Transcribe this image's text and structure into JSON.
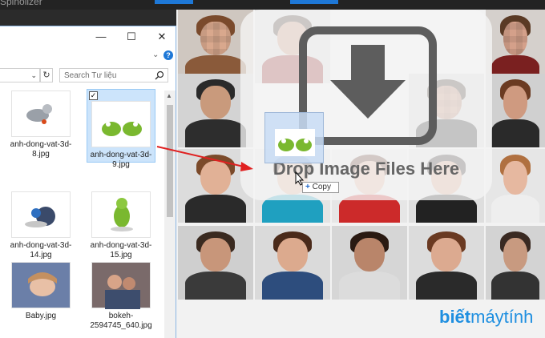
{
  "topbar": {
    "title": "Spinolizer"
  },
  "explorer": {
    "window_controls": {
      "minimize": "—",
      "maximize": "☐",
      "close": "✕"
    },
    "search_placeholder": "Search Tư liệu",
    "help": "?",
    "files": [
      {
        "name": "anh-dong-vat-3d-8.jpg",
        "selected": false
      },
      {
        "name": "anh-dong-vat-3d-9.jpg",
        "selected": true
      },
      {
        "name": "anh-dong-vat-3d-14.jpg",
        "selected": false
      },
      {
        "name": "anh-dong-vat-3d-15.jpg",
        "selected": false
      },
      {
        "name": "Baby.jpg",
        "selected": false
      },
      {
        "name": "bokeh-2594745_640.jpg",
        "selected": false
      }
    ]
  },
  "drop_zone": {
    "label": "Drop Image Files Here"
  },
  "drag": {
    "copy_label": "Copy"
  },
  "watermark": {
    "brand": "biết",
    "brand2": "máytính"
  },
  "colors": {
    "accent": "#1e78d7",
    "arrow": "#e02020",
    "watermark": "#1f8fe0"
  },
  "icons": [
    "search-icon",
    "refresh-icon",
    "help-icon",
    "download-arrow-icon",
    "cursor-icon"
  ]
}
